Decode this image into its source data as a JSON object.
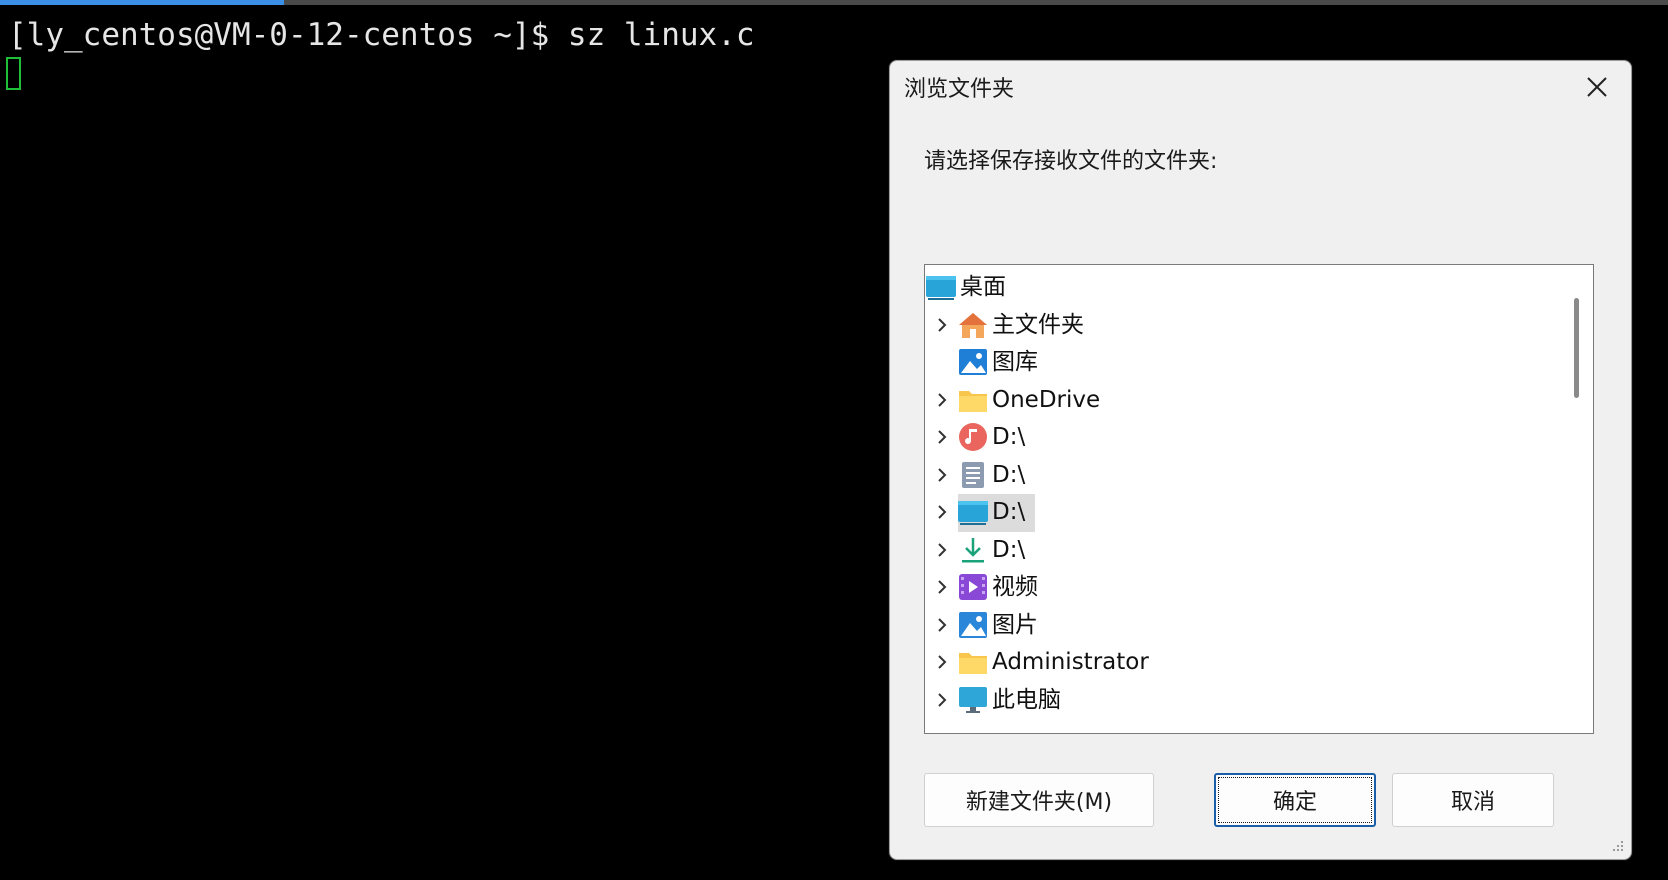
{
  "terminal": {
    "prompt_line": "[ly_centos@VM-0-12-centos ~]$ sz linux.c",
    "cursor_color": "#1fbf3a"
  },
  "top_progress": {
    "fraction": 0.17,
    "color": "#3c8fe6"
  },
  "dialog": {
    "title": "浏览文件夹",
    "close_icon": "close-icon",
    "prompt": "请选择保存接收文件的文件夹:",
    "tree": [
      {
        "label": "桌面",
        "icon": "desktop-icon",
        "expandable": false,
        "indent": 0
      },
      {
        "label": "主文件夹",
        "icon": "home-icon",
        "expandable": true,
        "indent": 1
      },
      {
        "label": "图库",
        "icon": "gallery-icon",
        "expandable": false,
        "indent": 1
      },
      {
        "label": "OneDrive",
        "icon": "folder-icon",
        "expandable": true,
        "indent": 1
      },
      {
        "label": "D:\\",
        "icon": "music-icon",
        "expandable": true,
        "indent": 1
      },
      {
        "label": "D:\\",
        "icon": "documents-icon",
        "expandable": true,
        "indent": 1
      },
      {
        "label": "D:\\",
        "icon": "desktop-icon",
        "expandable": true,
        "indent": 1,
        "selected": true
      },
      {
        "label": "D:\\",
        "icon": "download-icon",
        "expandable": true,
        "indent": 1
      },
      {
        "label": "视频",
        "icon": "video-icon",
        "expandable": true,
        "indent": 1
      },
      {
        "label": "图片",
        "icon": "pictures-icon",
        "expandable": true,
        "indent": 1
      },
      {
        "label": "Administrator",
        "icon": "folder-icon",
        "expandable": true,
        "indent": 1
      },
      {
        "label": "此电脑",
        "icon": "computer-icon",
        "expandable": true,
        "indent": 1
      }
    ],
    "buttons": {
      "new_folder": "新建文件夹(M)",
      "ok": "确定",
      "cancel": "取消"
    }
  }
}
